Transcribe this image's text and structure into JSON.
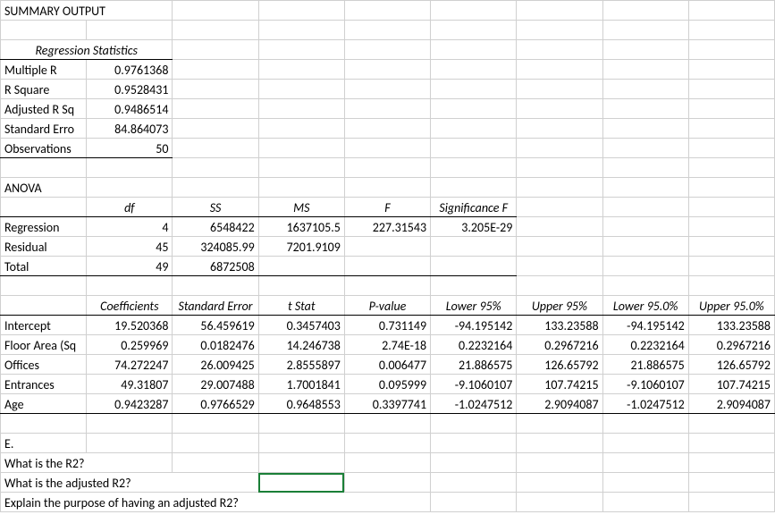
{
  "title": "SUMMARY OUTPUT",
  "regStatsHeader": "Regression Statistics",
  "stats": {
    "r0l": "Multiple R",
    "r0v": "0.9761368",
    "r1l": "R Square",
    "r1v": "0.9528431",
    "r2l": "Adjusted R Sq",
    "r2v": "0.9486514",
    "r3l": "Standard Erro",
    "r3v": "84.864073",
    "r4l": "Observations",
    "r4v": "50"
  },
  "anovaTitle": "ANOVA",
  "anovaHead": {
    "df": "df",
    "ss": "SS",
    "ms": "MS",
    "f": "F",
    "sig": "Significance F"
  },
  "anova": {
    "r0l": "Regression",
    "r0df": "4",
    "r0ss": "6548422",
    "r0ms": "1637105.5",
    "r0f": "227.31543",
    "r0sig": "3.205E-29",
    "r1l": "Residual",
    "r1df": "45",
    "r1ss": "324085.99",
    "r1ms": "7201.9109",
    "r2l": "Total",
    "r2df": "49",
    "r2ss": "6872508"
  },
  "coefHead": {
    "coef": "Coefficients",
    "se": "Standard Error",
    "t": "t Stat",
    "p": "P-value",
    "l95": "Lower 95%",
    "u95": "Upper 95%",
    "l95b": "Lower 95.0%",
    "u95b": "Upper 95.0%"
  },
  "coef": {
    "r0l": "Intercept",
    "r0c": "19.520368",
    "r0s": "56.459619",
    "r0t": "0.3457403",
    "r0p": "0.731149",
    "r0l9": "-94.195142",
    "r0u9": "133.23588",
    "r0l9b": "-94.195142",
    "r0u9b": "133.23588",
    "r1l": "Floor Area (Sq",
    "r1c": "0.259969",
    "r1s": "0.0182476",
    "r1t": "14.246738",
    "r1p": "2.74E-18",
    "r1l9": "0.2232164",
    "r1u9": "0.2967216",
    "r1l9b": "0.2232164",
    "r1u9b": "0.2967216",
    "r2l": "Offices",
    "r2c": "74.272247",
    "r2s": "26.009425",
    "r2t": "2.8555897",
    "r2p": "0.006477",
    "r2l9": "21.886575",
    "r2u9": "126.65792",
    "r2l9b": "21.886575",
    "r2u9b": "126.65792",
    "r3l": "Entrances",
    "r3c": "49.31807",
    "r3s": "29.007488",
    "r3t": "1.7001841",
    "r3p": "0.095999",
    "r3l9": "-9.1060107",
    "r3u9": "107.74215",
    "r3l9b": "-9.1060107",
    "r3u9b": "107.74215",
    "r4l": "Age",
    "r4c": "0.9423287",
    "r4s": "0.9766529",
    "r4t": "0.9648553",
    "r4p": "0.3397741",
    "r4l9": "-1.0247512",
    "r4u9": "2.9094087",
    "r4l9b": "-1.0247512",
    "r4u9b": "2.9094087"
  },
  "q": {
    "e": "E.",
    "q1": "What is the R2?",
    "q2": "What is the adjusted R2?",
    "q3": "Explain the purpose of having an adjusted R2?"
  }
}
